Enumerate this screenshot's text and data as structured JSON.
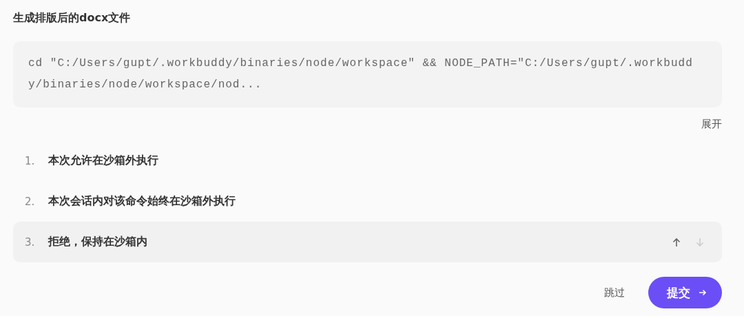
{
  "title": "生成排版后的docx文件",
  "command": "cd \"C:/Users/gupt/.workbuddy/binaries/node/workspace\" && NODE_PATH=\"C:/Users/gupt/.workbuddy/binaries/node/workspace/nod...",
  "expand_link": "展开",
  "options": [
    {
      "number": "1.",
      "label": "本次允许在沙箱外执行",
      "selected": false
    },
    {
      "number": "2.",
      "label": "本次会话内对该命令始终在沙箱外执行",
      "selected": false
    },
    {
      "number": "3.",
      "label": "拒绝，保持在沙箱内",
      "selected": true
    }
  ],
  "move_up": {
    "disabled": false
  },
  "move_down": {
    "disabled": true
  },
  "skip_button": "跳过",
  "submit_button": "提交"
}
